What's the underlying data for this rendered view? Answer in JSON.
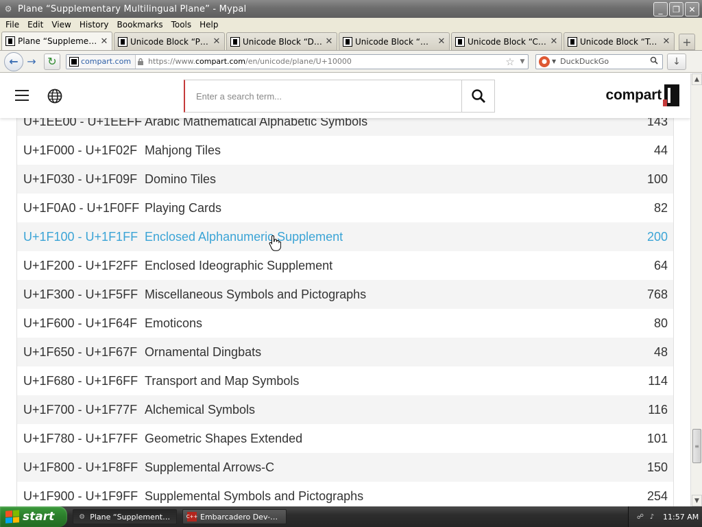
{
  "window": {
    "title": "Plane “Supplementary Multilingual Plane” - Mypal",
    "minimize": "_",
    "restore": "❐",
    "close": "✕"
  },
  "menu": [
    "File",
    "Edit",
    "View",
    "History",
    "Bookmarks",
    "Tools",
    "Help"
  ],
  "tabs": [
    {
      "label": "Plane “Supplementary ...",
      "active": true
    },
    {
      "label": "Unicode Block “Playing ..."
    },
    {
      "label": "Unicode Block “Domino ..."
    },
    {
      "label": "Unicode Block “Mahjon..."
    },
    {
      "label": "Unicode Block “Countin..."
    },
    {
      "label": "Unicode Block “Tai Xua..."
    }
  ],
  "tab_close": "✕",
  "new_tab": "+",
  "nav": {
    "site_identity": "compart.com",
    "url_prefix": "https://www.",
    "url_domain": "compart.com",
    "url_path": "/en/unicode/plane/U+10000",
    "search_engine": "DuckDuckGo",
    "back_glyph": "←",
    "forward_glyph": "→",
    "reload_glyph": "↻",
    "star_glyph": "☆",
    "drop_glyph": "▼",
    "download_glyph": "↓",
    "mag_glyph": "⌕"
  },
  "site": {
    "search_placeholder": "Enter a search term...",
    "logo_text": "compart",
    "accent": "#c53a3a",
    "hover_color": "#3ba4d6"
  },
  "blocks": [
    {
      "range": "U+1EE00 - U+1EEFF",
      "name": "Arabic Mathematical Alphabetic Symbols",
      "count": "143"
    },
    {
      "range": "U+1F000 - U+1F02F",
      "name": "Mahjong Tiles",
      "count": "44"
    },
    {
      "range": "U+1F030 - U+1F09F",
      "name": "Domino Tiles",
      "count": "100"
    },
    {
      "range": "U+1F0A0 - U+1F0FF",
      "name": "Playing Cards",
      "count": "82"
    },
    {
      "range": "U+1F100 - U+1F1FF",
      "name": "Enclosed Alphanumeric Supplement",
      "count": "200",
      "hover": true
    },
    {
      "range": "U+1F200 - U+1F2FF",
      "name": "Enclosed Ideographic Supplement",
      "count": "64"
    },
    {
      "range": "U+1F300 - U+1F5FF",
      "name": "Miscellaneous Symbols and Pictographs",
      "count": "768"
    },
    {
      "range": "U+1F600 - U+1F64F",
      "name": "Emoticons",
      "count": "80"
    },
    {
      "range": "U+1F650 - U+1F67F",
      "name": "Ornamental Dingbats",
      "count": "48"
    },
    {
      "range": "U+1F680 - U+1F6FF",
      "name": "Transport and Map Symbols",
      "count": "114"
    },
    {
      "range": "U+1F700 - U+1F77F",
      "name": "Alchemical Symbols",
      "count": "116"
    },
    {
      "range": "U+1F780 - U+1F7FF",
      "name": "Geometric Shapes Extended",
      "count": "101"
    },
    {
      "range": "U+1F800 - U+1F8FF",
      "name": "Supplemental Arrows-C",
      "count": "150"
    },
    {
      "range": "U+1F900 - U+1F9FF",
      "name": "Supplemental Symbols and Pictographs",
      "count": "254"
    }
  ],
  "scrollbar": {
    "up": "▲",
    "down": "▼",
    "grip": "≡"
  },
  "taskbar": {
    "start": "start",
    "tasks": [
      {
        "label": "Plane “Supplementar...",
        "active": true
      },
      {
        "label": "Embarcadero Dev-C++"
      }
    ],
    "clock": "11:57 AM"
  }
}
